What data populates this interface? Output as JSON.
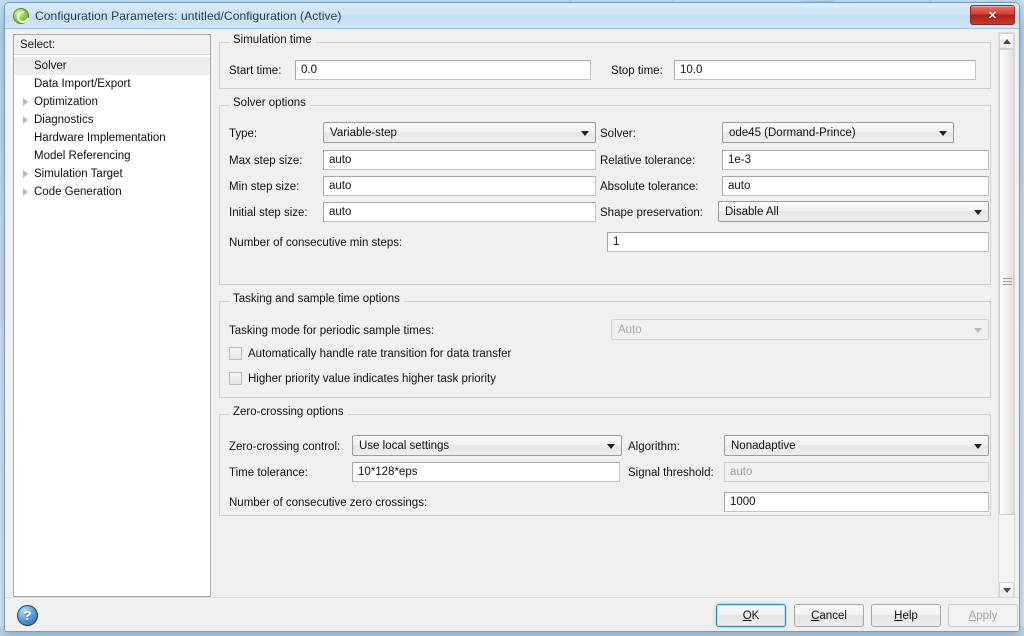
{
  "window": {
    "title": "Configuration Parameters: untitled/Configuration (Active)",
    "icon": "simulink-config-icon",
    "close_label": "✕"
  },
  "sidebar": {
    "header": "Select:",
    "items": [
      {
        "label": "Solver",
        "expandable": false,
        "selected": true
      },
      {
        "label": "Data Import/Export",
        "expandable": false,
        "selected": false
      },
      {
        "label": "Optimization",
        "expandable": true,
        "selected": false
      },
      {
        "label": "Diagnostics",
        "expandable": true,
        "selected": false
      },
      {
        "label": "Hardware Implementation",
        "expandable": false,
        "selected": false
      },
      {
        "label": "Model Referencing",
        "expandable": false,
        "selected": false
      },
      {
        "label": "Simulation Target",
        "expandable": true,
        "selected": false
      },
      {
        "label": "Code Generation",
        "expandable": true,
        "selected": false
      }
    ]
  },
  "simulation_time": {
    "group_title": "Simulation time",
    "start_time_label": "Start time:",
    "start_time_value": "0.0",
    "stop_time_label": "Stop time:",
    "stop_time_value": "10.0"
  },
  "solver_options": {
    "group_title": "Solver options",
    "type_label": "Type:",
    "type_value": "Variable-step",
    "solver_label": "Solver:",
    "solver_value": "ode45 (Dormand-Prince)",
    "max_step_label": "Max step size:",
    "max_step_value": "auto",
    "rel_tol_label": "Relative tolerance:",
    "rel_tol_value": "1e-3",
    "min_step_label": "Min step size:",
    "min_step_value": "auto",
    "abs_tol_label": "Absolute tolerance:",
    "abs_tol_value": "auto",
    "init_step_label": "Initial step size:",
    "init_step_value": "auto",
    "shape_pres_label": "Shape preservation:",
    "shape_pres_value": "Disable All",
    "min_steps_label": "Number of consecutive min steps:",
    "min_steps_value": "1"
  },
  "tasking": {
    "group_title": "Tasking and sample time options",
    "mode_label": "Tasking mode for periodic sample times:",
    "mode_value": "Auto",
    "auto_rate_label": "Automatically handle rate transition for data transfer",
    "priority_label": "Higher priority value indicates higher task priority"
  },
  "zero_crossing": {
    "group_title": "Zero-crossing options",
    "control_label": "Zero-crossing control:",
    "control_value": "Use local settings",
    "algorithm_label": "Algorithm:",
    "algorithm_value": "Nonadaptive",
    "time_tol_label": "Time tolerance:",
    "time_tol_value": "10*128*eps",
    "signal_thresh_label": "Signal threshold:",
    "signal_thresh_value": "auto",
    "zero_cross_count_label": "Number of consecutive zero crossings:",
    "zero_cross_count_value": "1000"
  },
  "footer": {
    "help_glyph": "?",
    "buttons": [
      {
        "name": "ok",
        "pre": "",
        "mnemonic": "O",
        "post": "K",
        "default": true,
        "disabled": false
      },
      {
        "name": "cancel",
        "pre": "",
        "mnemonic": "C",
        "post": "ancel",
        "default": false,
        "disabled": false
      },
      {
        "name": "help",
        "pre": "",
        "mnemonic": "H",
        "post": "elp",
        "default": false,
        "disabled": false
      },
      {
        "name": "apply",
        "pre": "",
        "mnemonic": "A",
        "post": "pply",
        "default": false,
        "disabled": true
      }
    ]
  },
  "scrollbar": {
    "up_arrow": "scroll-up",
    "down_arrow": "scroll-down"
  }
}
